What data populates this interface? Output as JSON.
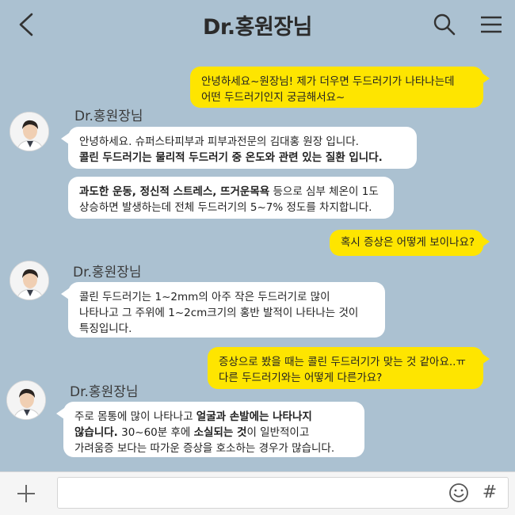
{
  "header": {
    "title": "Dr.홍원장님",
    "back_icon": "chevron-left-icon",
    "search_icon": "search-icon",
    "menu_icon": "hamburger-menu-icon"
  },
  "colors": {
    "background": "#abc1d1",
    "my_bubble": "#fee500",
    "their_bubble": "#ffffff"
  },
  "messages": [
    {
      "from": "me",
      "lines": [
        "안녕하세요~원장님! 제가 더우면 두드러기가 나타나는데",
        "어떤 두드러기인지 궁금해서요~"
      ]
    },
    {
      "from": "other",
      "sender": "Dr.홍원장님",
      "line1": "안녕하세요. 슈퍼스타피부과 피부과전문의 김대홍 원장 입니다.",
      "line2_bold": "콜린 두드러기는 물리적 두드러기 중 온도와 관련 있는 질환 입니다."
    },
    {
      "from": "other",
      "line1_bold": "과도한 운동, 정신적 스트레스, 뜨거운목욕",
      "line1_rest": " 등으로 심부 체온이 1도",
      "line2": "상승하면 발생하는데 전체 두드러기의 5~7% 정도를 차지합니다."
    },
    {
      "from": "me",
      "lines": [
        "혹시 증상은 어떻게 보이나요?"
      ]
    },
    {
      "from": "other",
      "sender": "Dr.홍원장님",
      "lines": [
        "콜린 두드러기는 1~2mm의 아주 작은 두드러기로 많이",
        "나타나고 그 주위에 1~2cm크기의 홍반 발적이 나타나는 것이",
        "특징입니다."
      ]
    },
    {
      "from": "me",
      "lines": [
        "증상으로 봤을 때는 콜린 두드러기가 맞는 것 같아요..ㅠ",
        "다른 두드러기와는 어떻게 다른가요?"
      ]
    },
    {
      "from": "other",
      "sender": "Dr.홍원장님",
      "l1_a": "주로 몸통에 많이 나타나고 ",
      "l1_b": "얼굴과 손발에는 나타나지",
      "l2_a": "않습니다.",
      "l2_b": " 30~60분 후에 ",
      "l2_c": "소실되는 것",
      "l2_d": "이 일반적이고",
      "l3": "가려움증 보다는 따가운 증상을 호소하는 경우가 많습니다."
    }
  ],
  "input_bar": {
    "placeholder": "",
    "plus_icon": "plus-icon",
    "emoji_icon": "emoji-smile-icon",
    "hash_label": "#"
  }
}
